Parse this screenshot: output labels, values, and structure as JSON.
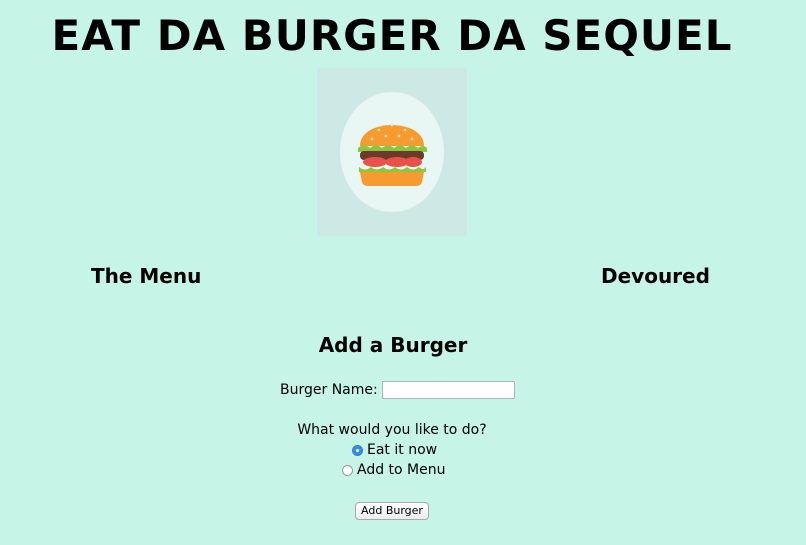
{
  "header": {
    "title": "EAT DA BURGER DA SEQUEL"
  },
  "logo": {
    "icon": "burger-icon",
    "background_color": "#cde9e6",
    "circle_color": "#e8f6f4"
  },
  "columns": {
    "menu_heading": "The Menu",
    "devoured_heading": "Devoured"
  },
  "form": {
    "heading": "Add a Burger",
    "name_label": "Burger Name:",
    "name_value": "",
    "name_placeholder": "",
    "question": "What would you like to do?",
    "options": [
      {
        "label": "Eat it now",
        "selected": true
      },
      {
        "label": "Add to Menu",
        "selected": false
      }
    ],
    "submit_label": "Add Burger"
  },
  "colors": {
    "page_background": "#c6f4e6",
    "radio_accent": "#3a8ee6"
  }
}
